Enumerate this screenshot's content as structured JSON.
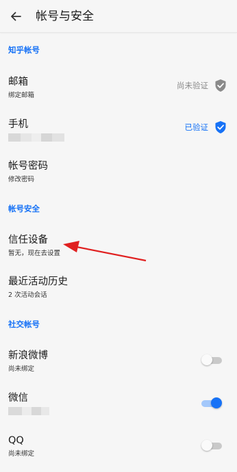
{
  "header": {
    "title": "帐号与安全"
  },
  "sections": {
    "zhihu": "知乎帐号",
    "security": "帐号安全",
    "social": "社交帐号"
  },
  "email": {
    "label": "邮箱",
    "sub": "绑定邮箱",
    "status": "尚未验证",
    "status_color": "#8a8a8a",
    "icon": "shield-check-icon-grey"
  },
  "phone": {
    "label": "手机",
    "sub_masked": true,
    "status": "已验证",
    "status_color": "#1772f6",
    "icon": "shield-check-icon-blue"
  },
  "password": {
    "label": "帐号密码",
    "sub": "修改密码"
  },
  "trusted": {
    "label": "信任设备",
    "sub": "暂无，现在去设置"
  },
  "history": {
    "label": "最近活动历史",
    "sub": "2 次活动会话"
  },
  "weibo": {
    "label": "新浪微博",
    "sub": "尚未绑定",
    "toggle_on": false
  },
  "wechat": {
    "label": "微信",
    "sub_masked": true,
    "toggle_on": true
  },
  "qq": {
    "label": "QQ",
    "sub": "尚未绑定",
    "toggle_on": false
  },
  "colors": {
    "accent": "#1772f6",
    "annotation_arrow": "#e02020"
  }
}
